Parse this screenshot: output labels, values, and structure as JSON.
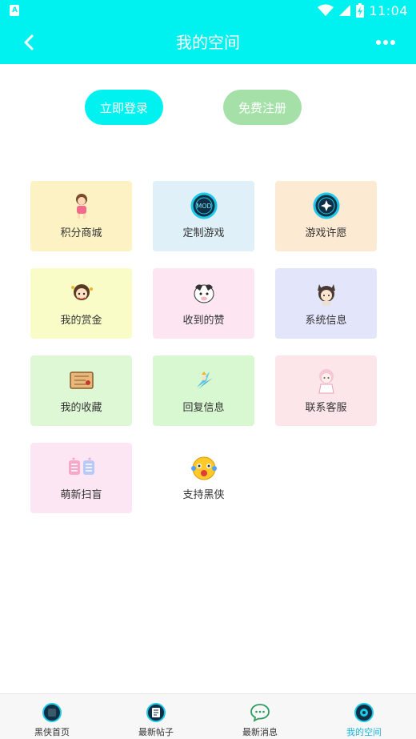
{
  "status_bar": {
    "time": "11:04"
  },
  "header": {
    "title": "我的空间"
  },
  "auth": {
    "login_label": "立即登录",
    "register_label": "免费注册"
  },
  "tiles": [
    {
      "label": "积分商城",
      "icon": "girl-avatar-icon",
      "bg": "#fdf2c4"
    },
    {
      "label": "定制游戏",
      "icon": "mod-badge-icon",
      "bg": "#dff0f8"
    },
    {
      "label": "游戏许愿",
      "icon": "wish-badge-icon",
      "bg": "#fdead3"
    },
    {
      "label": "我的赏金",
      "icon": "bounty-avatar-icon",
      "bg": "#fafcc8"
    },
    {
      "label": "收到的赞",
      "icon": "cow-avatar-icon",
      "bg": "#fde6f2"
    },
    {
      "label": "系统信息",
      "icon": "cat-ear-avatar-icon",
      "bg": "#e3e5fb"
    },
    {
      "label": "我的收藏",
      "icon": "treasure-map-icon",
      "bg": "#def8d6"
    },
    {
      "label": "回复信息",
      "icon": "fairy-icon",
      "bg": "#d8f8d1"
    },
    {
      "label": "联系客服",
      "icon": "service-girl-icon",
      "bg": "#fde6ea"
    },
    {
      "label": "萌新扫盲",
      "icon": "newbie-text-icon",
      "bg": "#fde6f3"
    },
    {
      "label": "支持黑侠",
      "icon": "surprised-face-icon",
      "bg": "#ffffff"
    }
  ],
  "bottom_nav": [
    {
      "label": "黑侠首页",
      "icon": "home-badge-icon",
      "active": false
    },
    {
      "label": "最新帖子",
      "icon": "posts-badge-icon",
      "active": false
    },
    {
      "label": "最新消息",
      "icon": "chat-bubble-icon",
      "active": false
    },
    {
      "label": "我的空间",
      "icon": "space-badge-icon",
      "active": true
    }
  ]
}
